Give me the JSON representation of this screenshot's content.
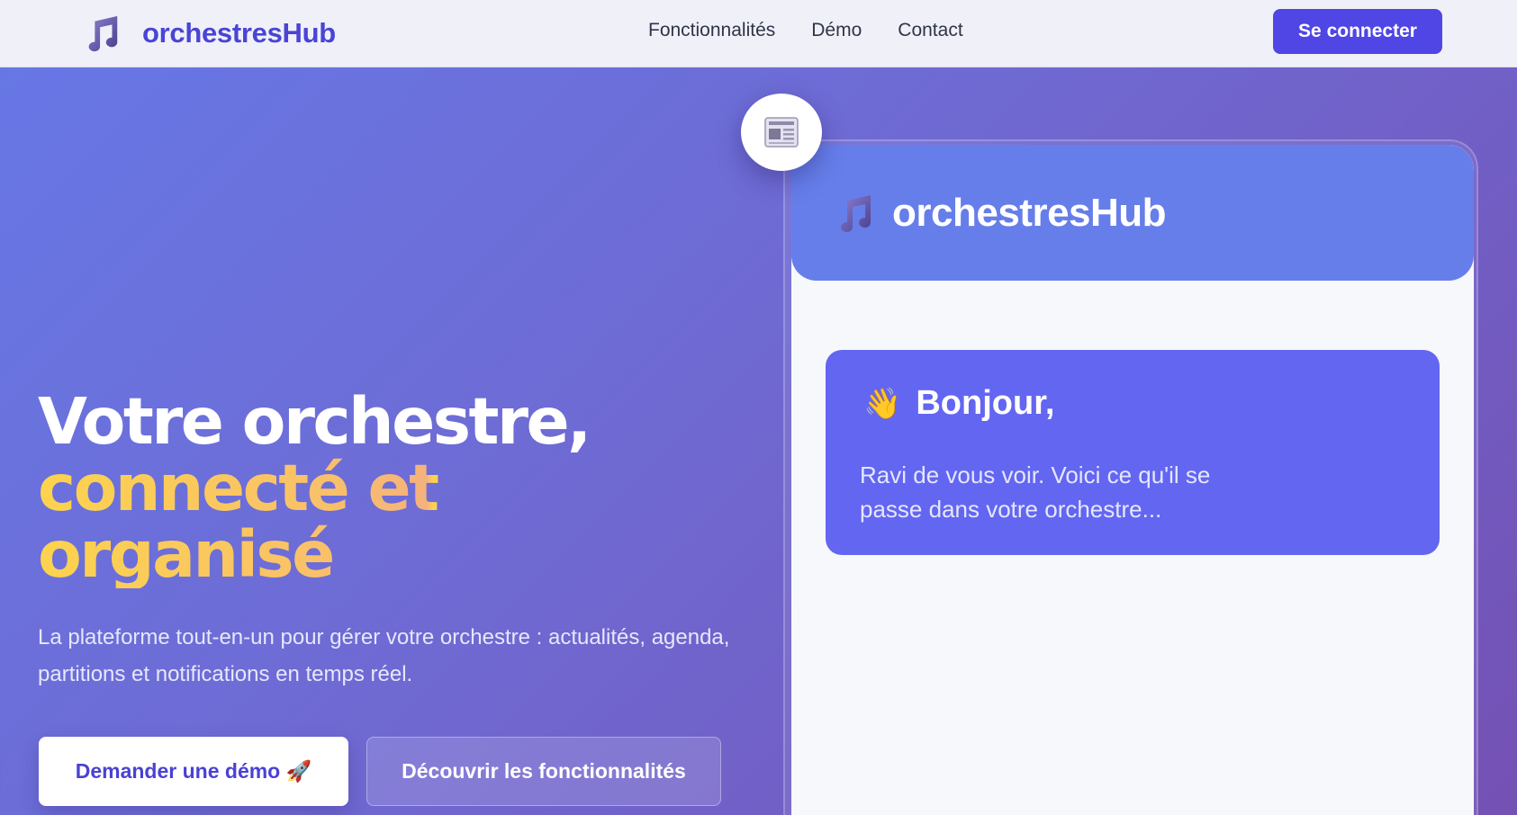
{
  "nav": {
    "brand": "orchestresHub",
    "brand_icon": "music-note-icon",
    "links": [
      "Fonctionnalités",
      "Démo",
      "Contact"
    ],
    "login_label": "Se connecter"
  },
  "hero": {
    "title_line1": "Votre orchestre,",
    "title_line2": "connecté et",
    "title_line3": "organisé",
    "subtitle": "La plateforme tout-en-un pour gérer votre orchestre : actualités, agenda, partitions et notifications en temps réel.",
    "primary_cta": "Demander une démo 🚀",
    "secondary_cta": "Découvrir les fonctionnalités"
  },
  "mockup": {
    "brand": "orchestresHub",
    "brand_icon": "music-note-icon",
    "badge_icon": "newspaper-icon",
    "welcome_emoji": "👋",
    "welcome_title": "Bonjour,",
    "welcome_text": "Ravi de vous voir. Voici ce qu'il se passe dans votre orchestre..."
  },
  "colors": {
    "brand": "#4f46e5",
    "accent_yellow": "#fcd34d",
    "card": "#6366f1",
    "header": "#667eea"
  }
}
